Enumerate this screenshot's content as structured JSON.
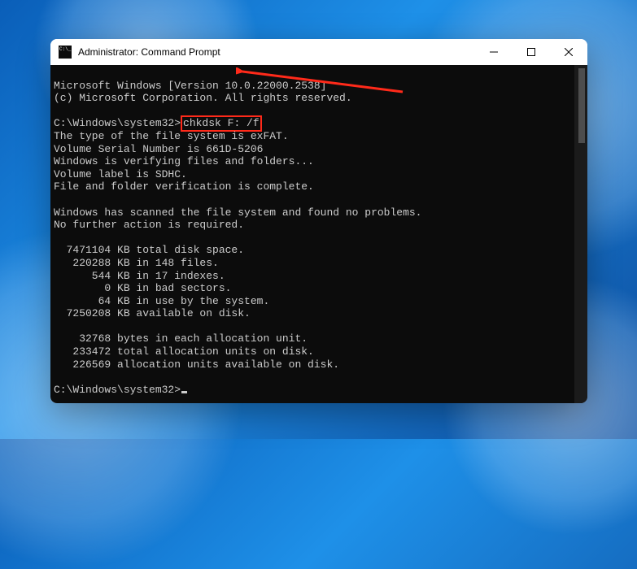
{
  "window": {
    "title": "Administrator: Command Prompt"
  },
  "terminal": {
    "header1": "Microsoft Windows [Version 10.0.22000.2538]",
    "header2": "(c) Microsoft Corporation. All rights reserved.",
    "prompt1_path": "C:\\Windows\\system32>",
    "command": "chkdsk F: /f",
    "out1": "The type of the file system is exFAT.",
    "out2": "Volume Serial Number is 661D-5206",
    "out3": "Windows is verifying files and folders...",
    "out4": "Volume label is SDHC.",
    "out5": "File and folder verification is complete.",
    "out6": "Windows has scanned the file system and found no problems.",
    "out7": "No further action is required.",
    "s1": "  7471104 KB total disk space.",
    "s2": "   220288 KB in 148 files.",
    "s3": "      544 KB in 17 indexes.",
    "s4": "        0 KB in bad sectors.",
    "s5": "       64 KB in use by the system.",
    "s6": "  7250208 KB available on disk.",
    "a1": "    32768 bytes in each allocation unit.",
    "a2": "   233472 total allocation units on disk.",
    "a3": "   226569 allocation units available on disk.",
    "prompt2_path": "C:\\Windows\\system32>"
  }
}
